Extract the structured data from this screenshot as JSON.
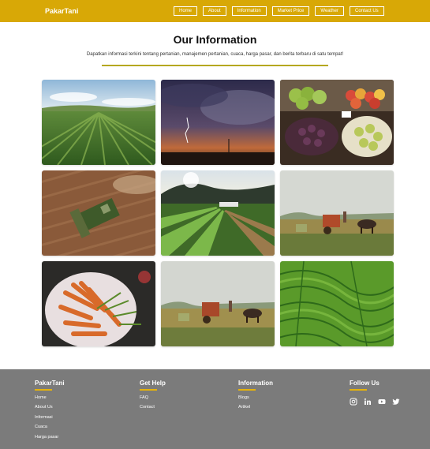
{
  "brand": "PakarTani",
  "nav": [
    {
      "label": "Home"
    },
    {
      "label": "About"
    },
    {
      "label": "Information"
    },
    {
      "label": "Market Price"
    },
    {
      "label": "Weather"
    },
    {
      "label": "Contact Us"
    }
  ],
  "section": {
    "title": "Our Information",
    "subtitle": "Dapatkan informasi terkini tentang pertanian, manajemen pertanian, cuaca, harga pasar, dan berita terbaru di satu tempat!"
  },
  "gallery": [
    {
      "name": "photo-green-crop-field"
    },
    {
      "name": "photo-lightning-storm"
    },
    {
      "name": "photo-market-produce"
    },
    {
      "name": "photo-harvester-aerial"
    },
    {
      "name": "photo-vegetable-rows"
    },
    {
      "name": "photo-oxcart-harvest"
    },
    {
      "name": "photo-carrots-bag"
    },
    {
      "name": "photo-oxcart-harvest-2"
    },
    {
      "name": "photo-terraced-fields"
    }
  ],
  "footer": {
    "brand": {
      "title": "PakarTani",
      "links": [
        "Home",
        "About Us",
        "Informasi",
        "Cuaca",
        "Harga pasar"
      ]
    },
    "help": {
      "title": "Get Help",
      "links": [
        "FAQ",
        "Contact"
      ]
    },
    "info": {
      "title": "Information",
      "links": [
        "Blogs",
        "Artikel"
      ]
    },
    "follow": {
      "title": "Follow Us",
      "icons": [
        "instagram-icon",
        "linkedin-icon",
        "youtube-icon",
        "twitter-icon"
      ]
    }
  },
  "colors": {
    "header": "#d8a806",
    "footer": "#7b7b7b",
    "accent": "#e5b20a",
    "divider": "#b5a820"
  }
}
